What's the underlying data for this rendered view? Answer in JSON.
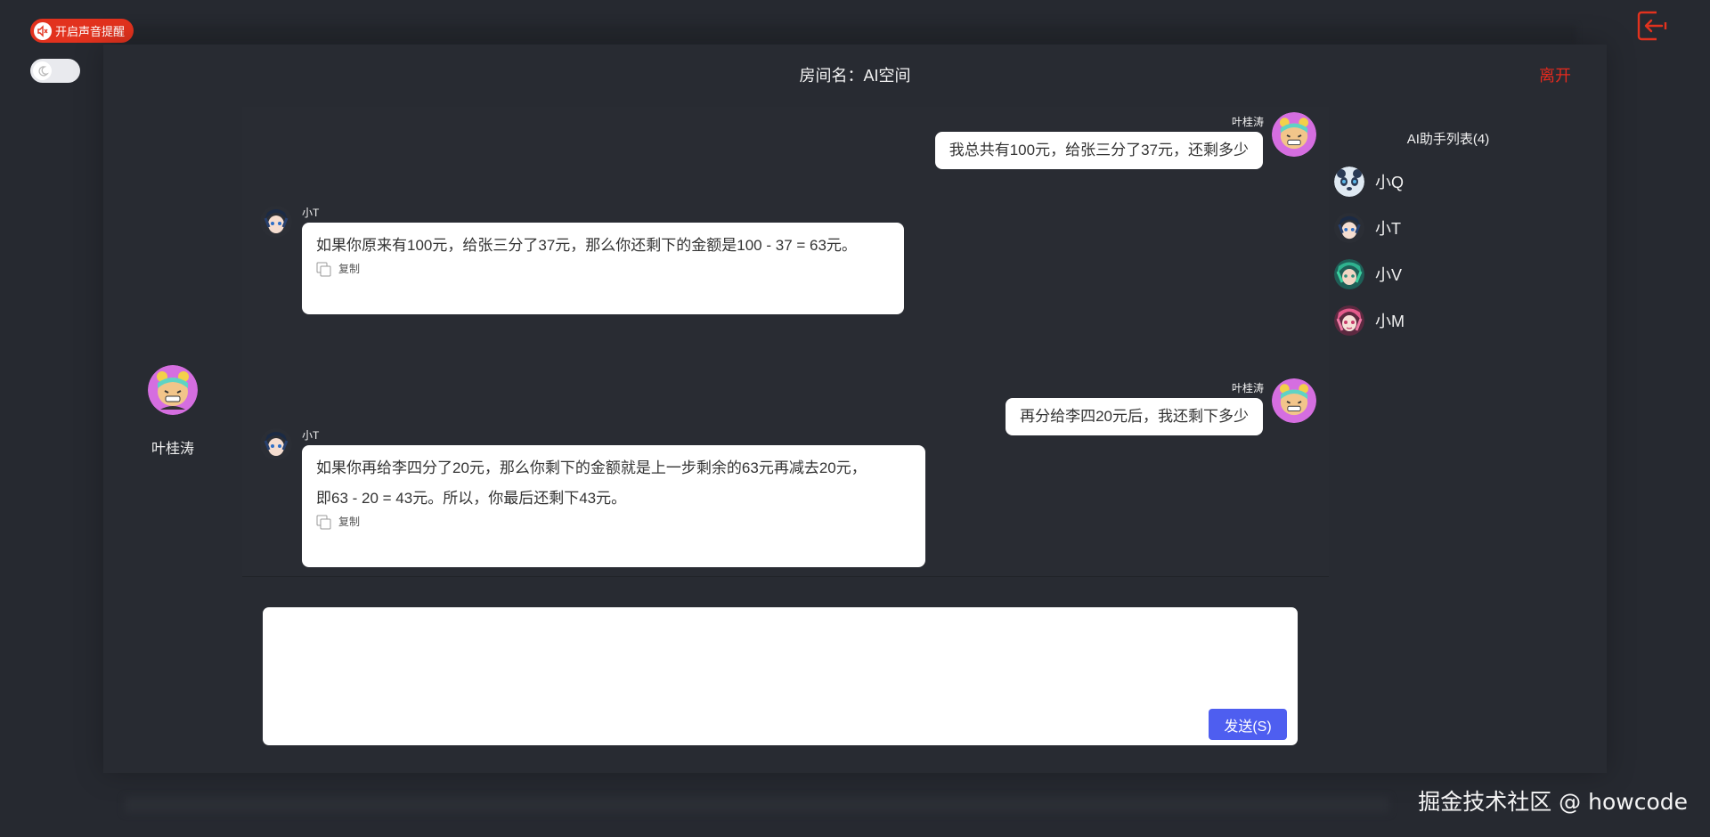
{
  "header": {
    "sound_label": "开启声音提醒",
    "room_title": "房间名：AI空间",
    "leave_label": "离开"
  },
  "me": {
    "name": "叶桂涛"
  },
  "messages": [
    {
      "sender": "叶桂涛",
      "self": true,
      "text": "我总共有100元，给张三分了37元，还剩多少"
    },
    {
      "sender": "小T",
      "self": false,
      "lines": [
        "如果你原来有100元，给张三分了37元，那么你还剩下的金额是100 - 37 = 63元。"
      ],
      "copy": "复制"
    },
    {
      "sender": "叶桂涛",
      "self": true,
      "text": "再分给李四20元后，我还剩下多少"
    },
    {
      "sender": "小T",
      "self": false,
      "lines": [
        "如果你再给李四分了20元，那么你剩下的金额就是上一步剩余的63元再减去20元，",
        "即63 - 20 = 43元。所以，你最后还剩下43元。"
      ],
      "copy": "复制"
    }
  ],
  "input": {
    "value": "",
    "send_label": "发送(S)"
  },
  "ai_list": {
    "title": "AI助手列表(4)",
    "items": [
      {
        "label": "小Q"
      },
      {
        "label": "小T"
      },
      {
        "label": "小V"
      },
      {
        "label": "小M"
      }
    ]
  },
  "watermark": "掘金技术社区 @ howcode",
  "colors": {
    "accent": "#4e5ef0",
    "danger": "#e52a1e",
    "background": "#262930"
  }
}
